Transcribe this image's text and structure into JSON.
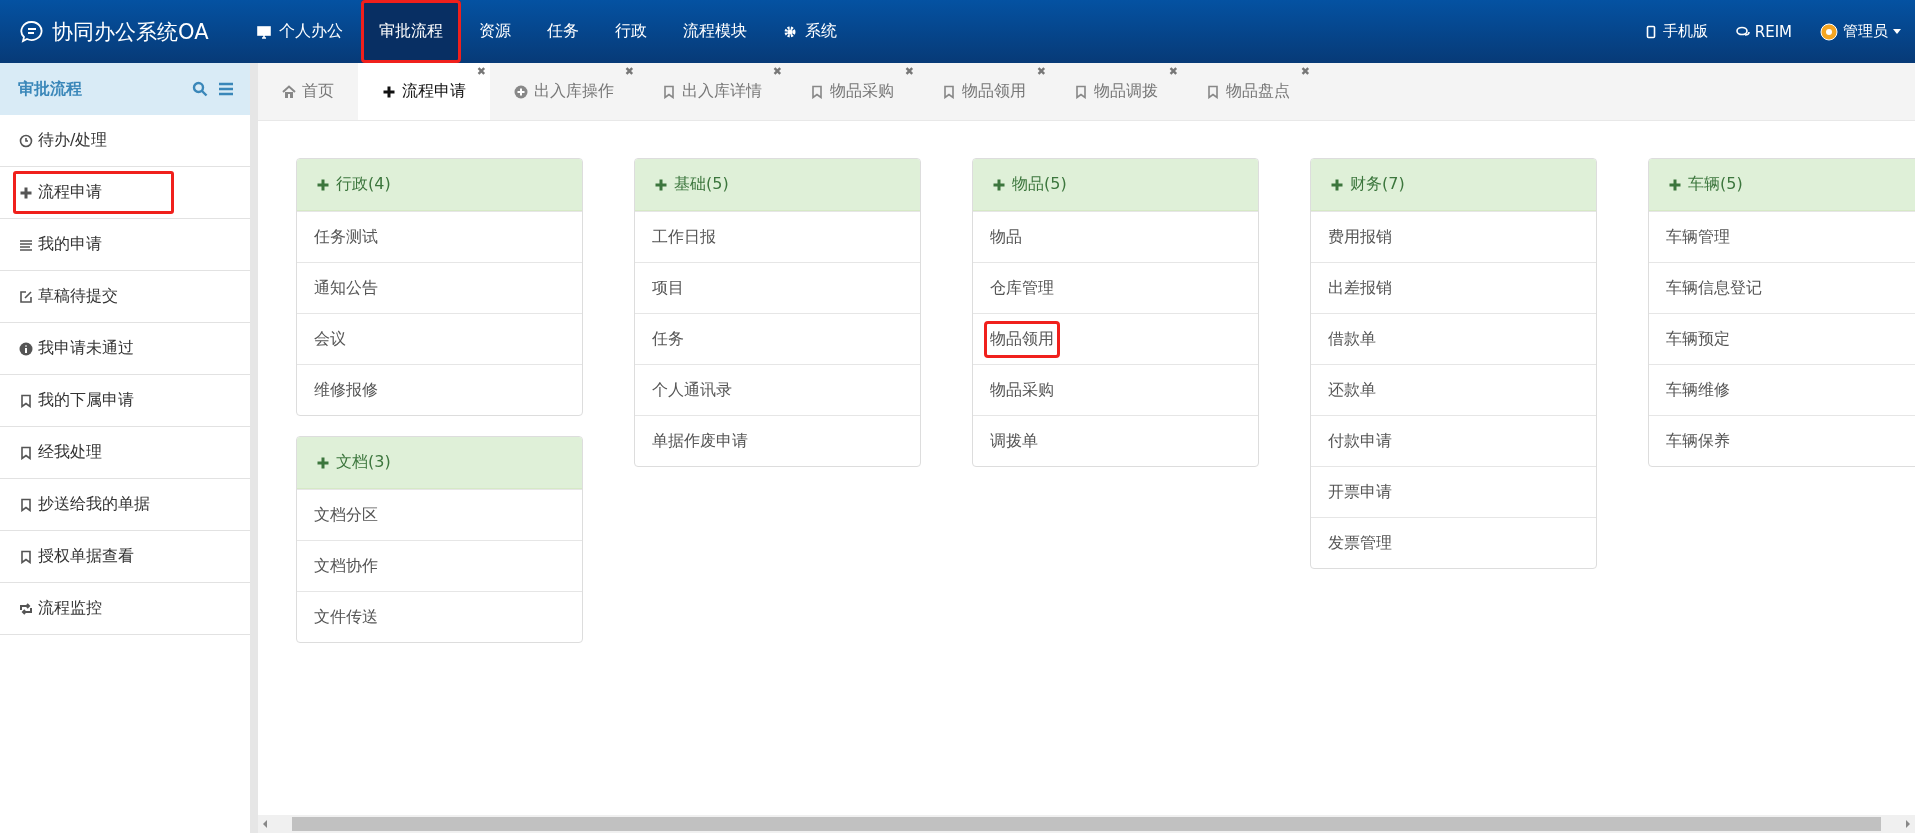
{
  "brand": {
    "title": "协同办公系统OA"
  },
  "nav": [
    {
      "label": "个人办公",
      "kind": "monitor",
      "selected": false,
      "annotated": false
    },
    {
      "label": "审批流程",
      "kind": "plain",
      "selected": true,
      "annotated": true
    },
    {
      "label": "资源",
      "kind": "plain",
      "selected": false,
      "annotated": false
    },
    {
      "label": "任务",
      "kind": "plain",
      "selected": false,
      "annotated": false
    },
    {
      "label": "行政",
      "kind": "plain",
      "selected": false,
      "annotated": false
    },
    {
      "label": "流程模块",
      "kind": "plain",
      "selected": false,
      "annotated": false
    },
    {
      "label": "系统",
      "kind": "settings",
      "selected": false,
      "annotated": false
    }
  ],
  "nav_right": [
    {
      "label": "手机版",
      "kind": "mobile"
    },
    {
      "label": "REIM",
      "kind": "chat"
    },
    {
      "label": "管理员",
      "kind": "user"
    }
  ],
  "sidebar": {
    "title": "审批流程",
    "items": [
      {
        "label": "待办/处理",
        "kind": "pending",
        "annotated": false
      },
      {
        "label": "流程申请",
        "kind": "apply",
        "annotated": true
      },
      {
        "label": "我的申请",
        "kind": "mine",
        "annotated": false
      },
      {
        "label": "草稿待提交",
        "kind": "draft",
        "annotated": false
      },
      {
        "label": "我申请未通过",
        "kind": "rejected",
        "annotated": false
      },
      {
        "label": "我的下属申请",
        "kind": "other",
        "annotated": false
      },
      {
        "label": "经我处理",
        "kind": "other",
        "annotated": false
      },
      {
        "label": "抄送给我的单据",
        "kind": "other",
        "annotated": false
      },
      {
        "label": "授权单据查看",
        "kind": "other",
        "annotated": false
      },
      {
        "label": "流程监控",
        "kind": "monitor",
        "annotated": false
      }
    ]
  },
  "tabs": [
    {
      "label": "首页",
      "kind": "home",
      "selected": false,
      "closable": false
    },
    {
      "label": "流程申请",
      "kind": "apply",
      "selected": true,
      "closable": true
    },
    {
      "label": "出入库操作",
      "kind": "operation",
      "selected": false,
      "closable": true
    },
    {
      "label": "出入库详情",
      "kind": "other",
      "selected": false,
      "closable": true
    },
    {
      "label": "物品采购",
      "kind": "other",
      "selected": false,
      "closable": true
    },
    {
      "label": "物品领用",
      "kind": "other",
      "selected": false,
      "closable": true
    },
    {
      "label": "物品调拨",
      "kind": "other",
      "selected": false,
      "closable": true
    },
    {
      "label": "物品盘点",
      "kind": "other",
      "selected": false,
      "closable": true
    }
  ],
  "close_glyph": "✖",
  "columns": [
    [
      {
        "title": "行政(4)",
        "items": [
          {
            "label": "任务测试",
            "annotated": false
          },
          {
            "label": "通知公告",
            "annotated": false
          },
          {
            "label": "会议",
            "annotated": false
          },
          {
            "label": "维修报修",
            "annotated": false
          }
        ]
      },
      {
        "title": "文档(3)",
        "items": [
          {
            "label": "文档分区",
            "annotated": false
          },
          {
            "label": "文档协作",
            "annotated": false
          },
          {
            "label": "文件传送",
            "annotated": false
          }
        ]
      }
    ],
    [
      {
        "title": "基础(5)",
        "items": [
          {
            "label": "工作日报",
            "annotated": false
          },
          {
            "label": "项目",
            "annotated": false
          },
          {
            "label": "任务",
            "annotated": false
          },
          {
            "label": "个人通讯录",
            "annotated": false
          },
          {
            "label": "单据作废申请",
            "annotated": false
          }
        ]
      }
    ],
    [
      {
        "title": "物品(5)",
        "items": [
          {
            "label": "物品",
            "annotated": false
          },
          {
            "label": "仓库管理",
            "annotated": false
          },
          {
            "label": "物品领用",
            "annotated": true
          },
          {
            "label": "物品采购",
            "annotated": false
          },
          {
            "label": "调拨单",
            "annotated": false
          }
        ]
      }
    ],
    [
      {
        "title": "财务(7)",
        "items": [
          {
            "label": "费用报销",
            "annotated": false
          },
          {
            "label": "出差报销",
            "annotated": false
          },
          {
            "label": "借款单",
            "annotated": false
          },
          {
            "label": "还款单",
            "annotated": false
          },
          {
            "label": "付款申请",
            "annotated": false
          },
          {
            "label": "开票申请",
            "annotated": false
          },
          {
            "label": "发票管理",
            "annotated": false
          }
        ]
      }
    ],
    [
      {
        "title": "车辆(5)",
        "items": [
          {
            "label": "车辆管理",
            "annotated": false
          },
          {
            "label": "车辆信息登记",
            "annotated": false
          },
          {
            "label": "车辆预定",
            "annotated": false
          },
          {
            "label": "车辆维修",
            "annotated": false
          },
          {
            "label": "车辆保养",
            "annotated": false
          }
        ]
      }
    ]
  ]
}
